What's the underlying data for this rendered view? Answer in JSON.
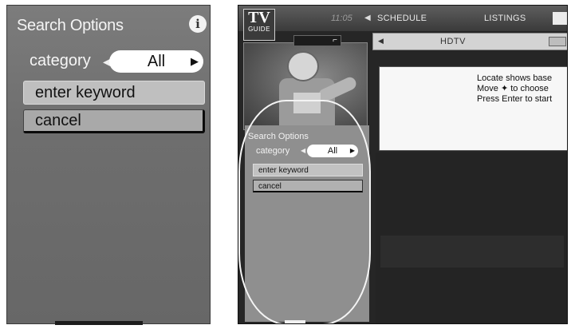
{
  "left_panel": {
    "title": "Search Options",
    "info_icon": "info-icon",
    "category_label": "category",
    "category_value": "All",
    "keyword_button": "enter keyword",
    "cancel_button": "cancel"
  },
  "tv_screen": {
    "logo_top": "TV",
    "logo_bottom": "GUIDE",
    "clock": "11:05",
    "nav": {
      "schedule": "SCHEDULE",
      "listings": "LISTINGS"
    },
    "channel_bar": "HDTV",
    "info_lines": [
      "Locate shows base",
      "Move ✦ to choose",
      "Press Enter to start"
    ],
    "mini_panel": {
      "title": "Search Options",
      "category_label": "category",
      "category_value": "All",
      "keyword_button": "enter keyword",
      "cancel_button": "cancel"
    }
  }
}
